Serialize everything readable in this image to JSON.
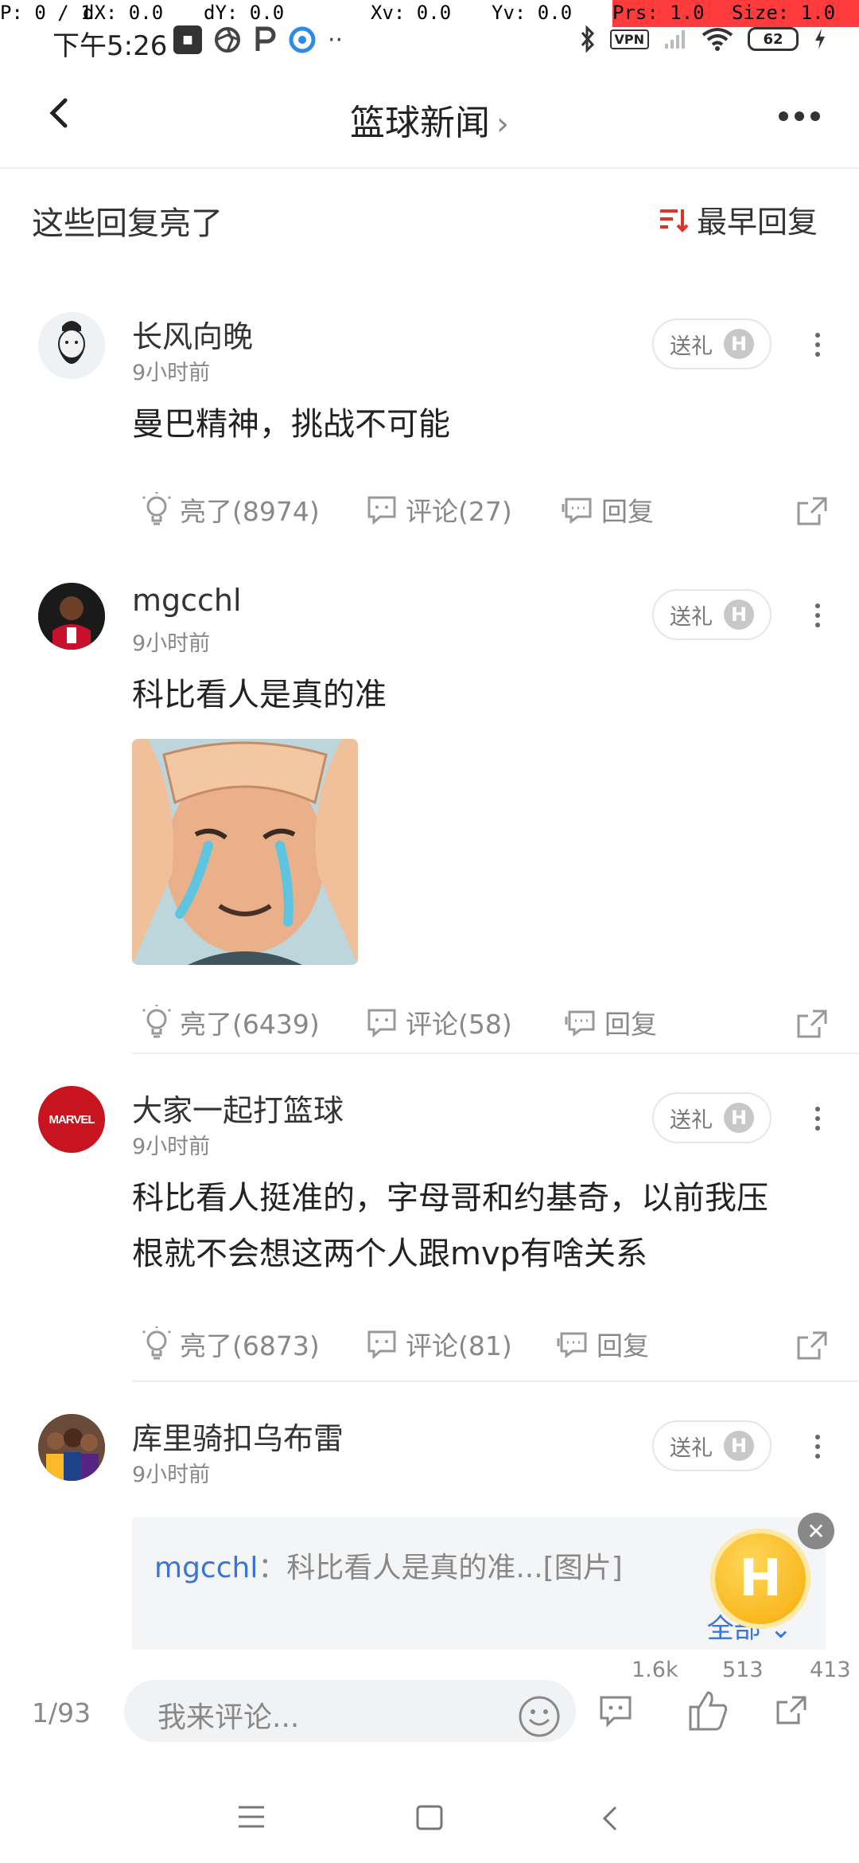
{
  "debug": {
    "p": "P: 0 / 1",
    "dx": "dX: 0.0",
    "dy": "dY: 0.0",
    "xv": "Xv: 0.0",
    "yv": "Yv: 0.0",
    "prs": "Prs: 1.0",
    "size": "Size: 1.0"
  },
  "status_bar": {
    "time": "下午5:26",
    "vpn": "VPN",
    "battery": "62"
  },
  "header": {
    "title": "篮球新闻",
    "title_chevron": "›"
  },
  "section": {
    "title": "这些回复亮了",
    "sort_label": "最早回复"
  },
  "comments": [
    {
      "username": "长风向晚",
      "time": "9小时前",
      "gift": "送礼",
      "text": "曼巴精神，挑战不可能",
      "light": "亮了(8974)",
      "comment": "评论(27)",
      "reply": "回复"
    },
    {
      "username": "mgcchl",
      "time": "9小时前",
      "gift": "送礼",
      "text": "科比看人是真的准",
      "light": "亮了(6439)",
      "comment": "评论(58)",
      "reply": "回复"
    },
    {
      "username": "大家一起打篮球",
      "time": "9小时前",
      "gift": "送礼",
      "text_line1": "科比看人挺准的，字母哥和约基奇，以前我压",
      "text_line2": "根就不会想这两个人跟mvp有啥关系",
      "light": "亮了(6873)",
      "comment": "评论(81)",
      "reply": "回复",
      "avatar_text": "MARVEL"
    },
    {
      "username": "库里骑扣乌布雷",
      "time": "9小时前",
      "gift": "送礼",
      "quote_user": "mgcchl",
      "quote_text": "：科比看人是真的准...[图片]",
      "quote_all": "全部"
    }
  ],
  "badge_letter": "H",
  "bottom_bar": {
    "page": "1/93",
    "placeholder": "我来评论...",
    "comment_count": "1.6k",
    "like_count": "513",
    "share_count": "413"
  },
  "colors": {
    "link_blue": "#3a74d6",
    "sort_red": "#e0312b",
    "gold": "#f6a800"
  }
}
